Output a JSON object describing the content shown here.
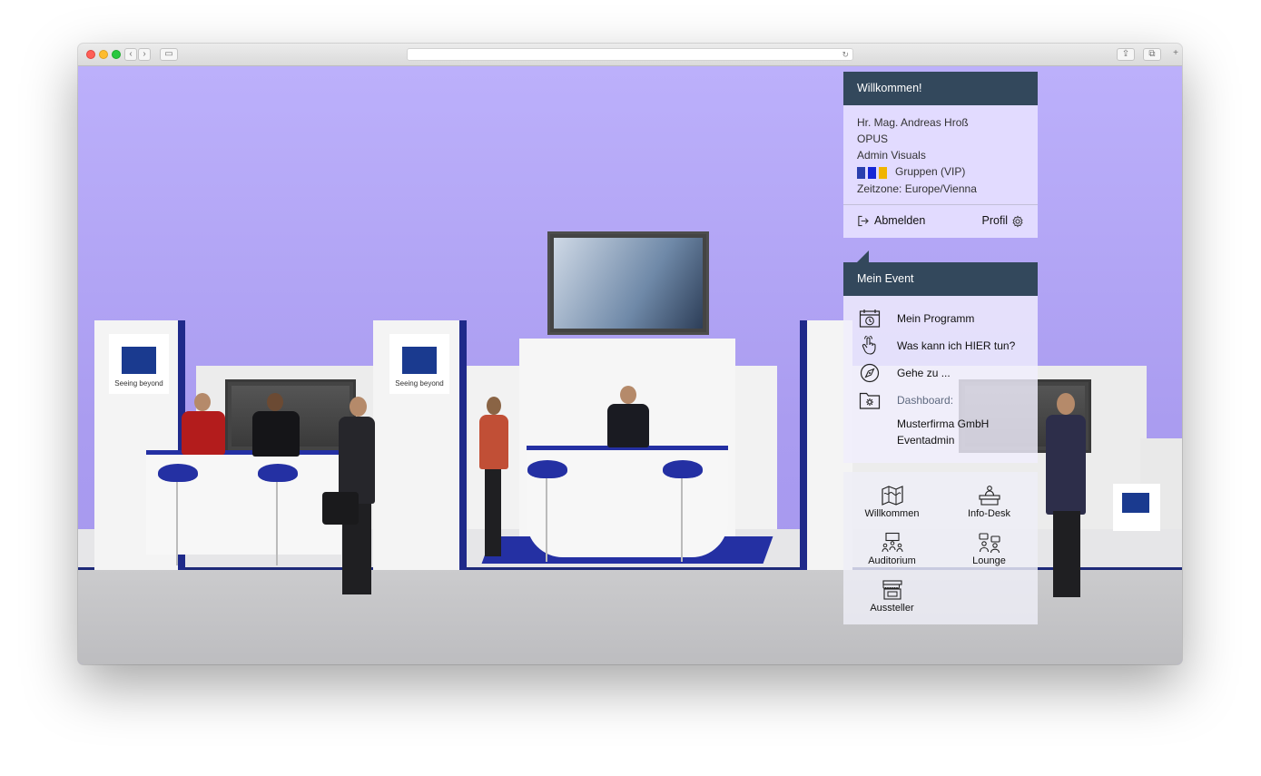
{
  "browser": {
    "back": "‹",
    "forward": "›",
    "sidebar": "▭",
    "reload": "↻",
    "share": "⇪",
    "tabs": "⧉",
    "new_tab": "+"
  },
  "scene": {
    "logo_text": "ZEISS",
    "logo_subtitle": "Seeing beyond"
  },
  "user_panel": {
    "title": "Willkommen!",
    "name": "Hr. Mag. Andreas Hroß",
    "company": "OPUS",
    "role": "Admin Visuals",
    "group": "Gruppen (VIP)",
    "group_colors": [
      "#2a3fae",
      "#1626d6",
      "#f0b400"
    ],
    "timezone": "Zeitzone: Europe/Vienna",
    "logout_label": "Abmelden",
    "logout_icon": "logout-icon",
    "profile_label": "Profil",
    "profile_icon": "gear-icon"
  },
  "event_panel": {
    "title": "Mein Event",
    "items": [
      {
        "label": "Mein Programm",
        "icon": "calendar-clock-icon"
      },
      {
        "label": "Was kann ich HIER tun?",
        "icon": "hand-pointer-icon"
      },
      {
        "label": "Gehe zu ...",
        "icon": "compass-icon"
      }
    ],
    "dashboard": {
      "label": "Dashboard:",
      "icon": "folder-gear-icon",
      "entries": [
        "Musterfirma GmbH",
        "Eventadmin"
      ]
    }
  },
  "nav_panel": {
    "items": [
      {
        "label": "Willkommen",
        "icon": "map-icon"
      },
      {
        "label": "Info-Desk",
        "icon": "info-desk-icon"
      },
      {
        "label": "Auditorium",
        "icon": "auditorium-icon"
      },
      {
        "label": "Lounge",
        "icon": "lounge-icon"
      },
      {
        "label": "Aussteller",
        "icon": "exhibitor-booth-icon"
      }
    ]
  }
}
